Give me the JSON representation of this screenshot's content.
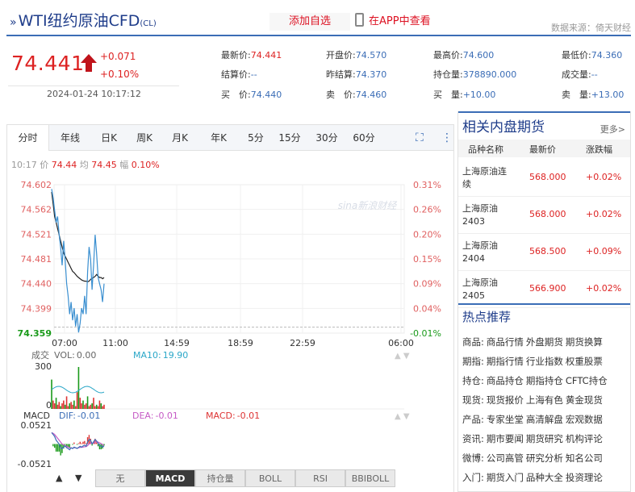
{
  "header": {
    "title": "WTI纽约原油CFD",
    "title_suffix": "(CL)",
    "add_favorite": "添加自选",
    "view_in_app": "在APP中查看",
    "data_source": "数据来源：倚天财经"
  },
  "quote": {
    "price": "74.441",
    "change": "+0.071",
    "change_pct": "+0.10%",
    "timestamp": "2024-01-24 10:17:12",
    "fields": [
      {
        "label": "最新价:",
        "value": "74.441",
        "tone": "r"
      },
      {
        "label": "开盘价:",
        "value": "74.570",
        "tone": "v"
      },
      {
        "label": "最高价:",
        "value": "74.600",
        "tone": "v"
      },
      {
        "label": "最低价:",
        "value": "74.360",
        "tone": "v"
      },
      {
        "label": "结算价:",
        "value": "--",
        "tone": "v"
      },
      {
        "label": "昨结算:",
        "value": "74.370",
        "tone": "v"
      },
      {
        "label": "持仓量:",
        "value": "378890.000",
        "tone": "v"
      },
      {
        "label": "成交量:",
        "value": "--",
        "tone": "v"
      },
      {
        "label": "买　价:",
        "value": "74.440",
        "tone": "v"
      },
      {
        "label": "卖　价:",
        "value": "74.460",
        "tone": "v"
      },
      {
        "label": "买　量:",
        "value": "+10.00",
        "tone": "v"
      },
      {
        "label": "卖　量:",
        "value": "+13.00",
        "tone": "v"
      }
    ]
  },
  "chart_tabs": [
    "分时",
    "年线",
    "日K",
    "周K",
    "月K",
    "年K",
    "5分",
    "15分",
    "30分",
    "60分"
  ],
  "chart_info": {
    "time": "10:17",
    "price_label": "价",
    "price": "74.44",
    "avg_label": "均",
    "avg": "74.45",
    "amp_label": "幅",
    "amp": "0.10%"
  },
  "watermark": "sina新浪财经",
  "chart_data": {
    "type": "line",
    "y_ticks": [
      "74.602",
      "74.562",
      "74.521",
      "74.481",
      "74.440",
      "74.399",
      "74.359"
    ],
    "pct_ticks": [
      "0.31%",
      "0.26%",
      "0.20%",
      "0.15%",
      "0.09%",
      "0.04%",
      "-0.01%"
    ],
    "x_ticks": [
      "07:00",
      "11:00",
      "14:59",
      "18:59",
      "22:59",
      "06:00"
    ],
    "ylim": [
      74.359,
      74.602
    ],
    "prev_settle": 74.37,
    "price_series": [
      74.595,
      74.58,
      74.56,
      74.54,
      74.55,
      74.52,
      74.5,
      74.47,
      74.51,
      74.48,
      74.44,
      74.42,
      74.39,
      74.41,
      74.38,
      74.4,
      74.37,
      74.39,
      74.36,
      74.375,
      74.4,
      74.39,
      74.42,
      74.39,
      74.46,
      74.5,
      74.48,
      74.43,
      74.47,
      74.52,
      74.49,
      74.45,
      74.44,
      74.43,
      74.41,
      74.44
    ],
    "avg_series": [
      74.59,
      74.57,
      74.55,
      74.54,
      74.53,
      74.52,
      74.51,
      74.5,
      74.49,
      74.485,
      74.48,
      74.475,
      74.47,
      74.465,
      74.46,
      74.458,
      74.455,
      74.452,
      74.45,
      74.448,
      74.446,
      74.445,
      74.444,
      74.444,
      74.443,
      74.444,
      74.447,
      74.449,
      74.45,
      74.452,
      74.455,
      74.452,
      74.45,
      74.45,
      74.448,
      74.45
    ],
    "volume": {
      "label": "成交",
      "vol_label": "VOL:",
      "vol": "0.00",
      "ma_label": "MA10:",
      "ma": "19.90",
      "max_tick": "300",
      "min_tick": "0",
      "bars": [
        210,
        60,
        40,
        80,
        30,
        50,
        20,
        40,
        60,
        30,
        90,
        20,
        40,
        50,
        30,
        60,
        20,
        120,
        300,
        80,
        40,
        60,
        30,
        40,
        90,
        20,
        30,
        40,
        80,
        20,
        30,
        20,
        60,
        40,
        20,
        30
      ]
    },
    "macd": {
      "label": "MACD",
      "dif_label": "DIF:",
      "dif": "-0.01",
      "dea_label": "DEA:",
      "dea": "-0.01",
      "macd_label": "MACD:",
      "macd": "-0.01",
      "max_tick": "0.0521",
      "min_tick": "-0.0521",
      "dif_series": [
        0.03,
        0.025,
        0.02,
        0.01,
        0.005,
        0.0,
        -0.01,
        -0.012,
        -0.008,
        -0.005,
        -0.01,
        -0.012,
        -0.015,
        -0.01,
        -0.012,
        -0.008,
        -0.01,
        -0.012,
        -0.009,
        -0.006,
        -0.008,
        -0.005,
        -0.003,
        -0.006,
        0.005,
        0.012,
        0.01,
        0.0,
        0.006,
        0.012,
        0.008,
        0.002,
        -0.004,
        -0.006,
        -0.008,
        -0.005
      ],
      "dea_series": [
        0.03,
        0.028,
        0.025,
        0.02,
        0.015,
        0.01,
        0.005,
        0.0,
        -0.002,
        -0.004,
        -0.006,
        -0.008,
        -0.01,
        -0.01,
        -0.011,
        -0.01,
        -0.01,
        -0.011,
        -0.01,
        -0.009,
        -0.009,
        -0.008,
        -0.007,
        -0.007,
        -0.004,
        0.0,
        0.003,
        0.002,
        0.003,
        0.005,
        0.006,
        0.005,
        0.003,
        0.001,
        -0.002,
        -0.003
      ]
    }
  },
  "indicator_buttons": [
    "无",
    "MACD",
    "持仓量",
    "BOLL",
    "RSI",
    "BBIBOLL"
  ],
  "related": {
    "title": "相关内盘期货",
    "more": "更多>",
    "columns": [
      "品种名称",
      "最新价",
      "涨跌幅"
    ],
    "rows": [
      {
        "name": "上海原油连续",
        "price": "568.000",
        "chg": "+0.02%"
      },
      {
        "name": "上海原油2403",
        "price": "568.000",
        "chg": "+0.02%"
      },
      {
        "name": "上海原油2404",
        "price": "568.500",
        "chg": "+0.09%"
      },
      {
        "name": "上海原油2405",
        "price": "566.900",
        "chg": "+0.02%"
      }
    ]
  },
  "hot": {
    "title": "热点推荐",
    "lines": [
      {
        "key": "商品:",
        "items": [
          "商品行情",
          "外盘期货",
          "期货换算"
        ]
      },
      {
        "key": "期指:",
        "items": [
          "期指行情",
          "行业指数",
          "权重股票"
        ]
      },
      {
        "key": "持仓:",
        "items": [
          "商品持仓",
          "期指持仓",
          "CFTC持仓"
        ]
      },
      {
        "key": "现货:",
        "items": [
          "现货报价",
          "上海有色",
          "黄金现货"
        ]
      },
      {
        "key": "产品:",
        "items": [
          "专家坐堂",
          "高清解盘",
          "宏观数据"
        ]
      },
      {
        "key": "资讯:",
        "items": [
          "期市要闻",
          "期货研究",
          "机构评论"
        ]
      },
      {
        "key": "微博:",
        "items": [
          "公司高管",
          "研究分析",
          "知名公司"
        ]
      },
      {
        "key": "入门:",
        "items": [
          "期货入门",
          "品种大全",
          "投资理论"
        ]
      }
    ]
  }
}
